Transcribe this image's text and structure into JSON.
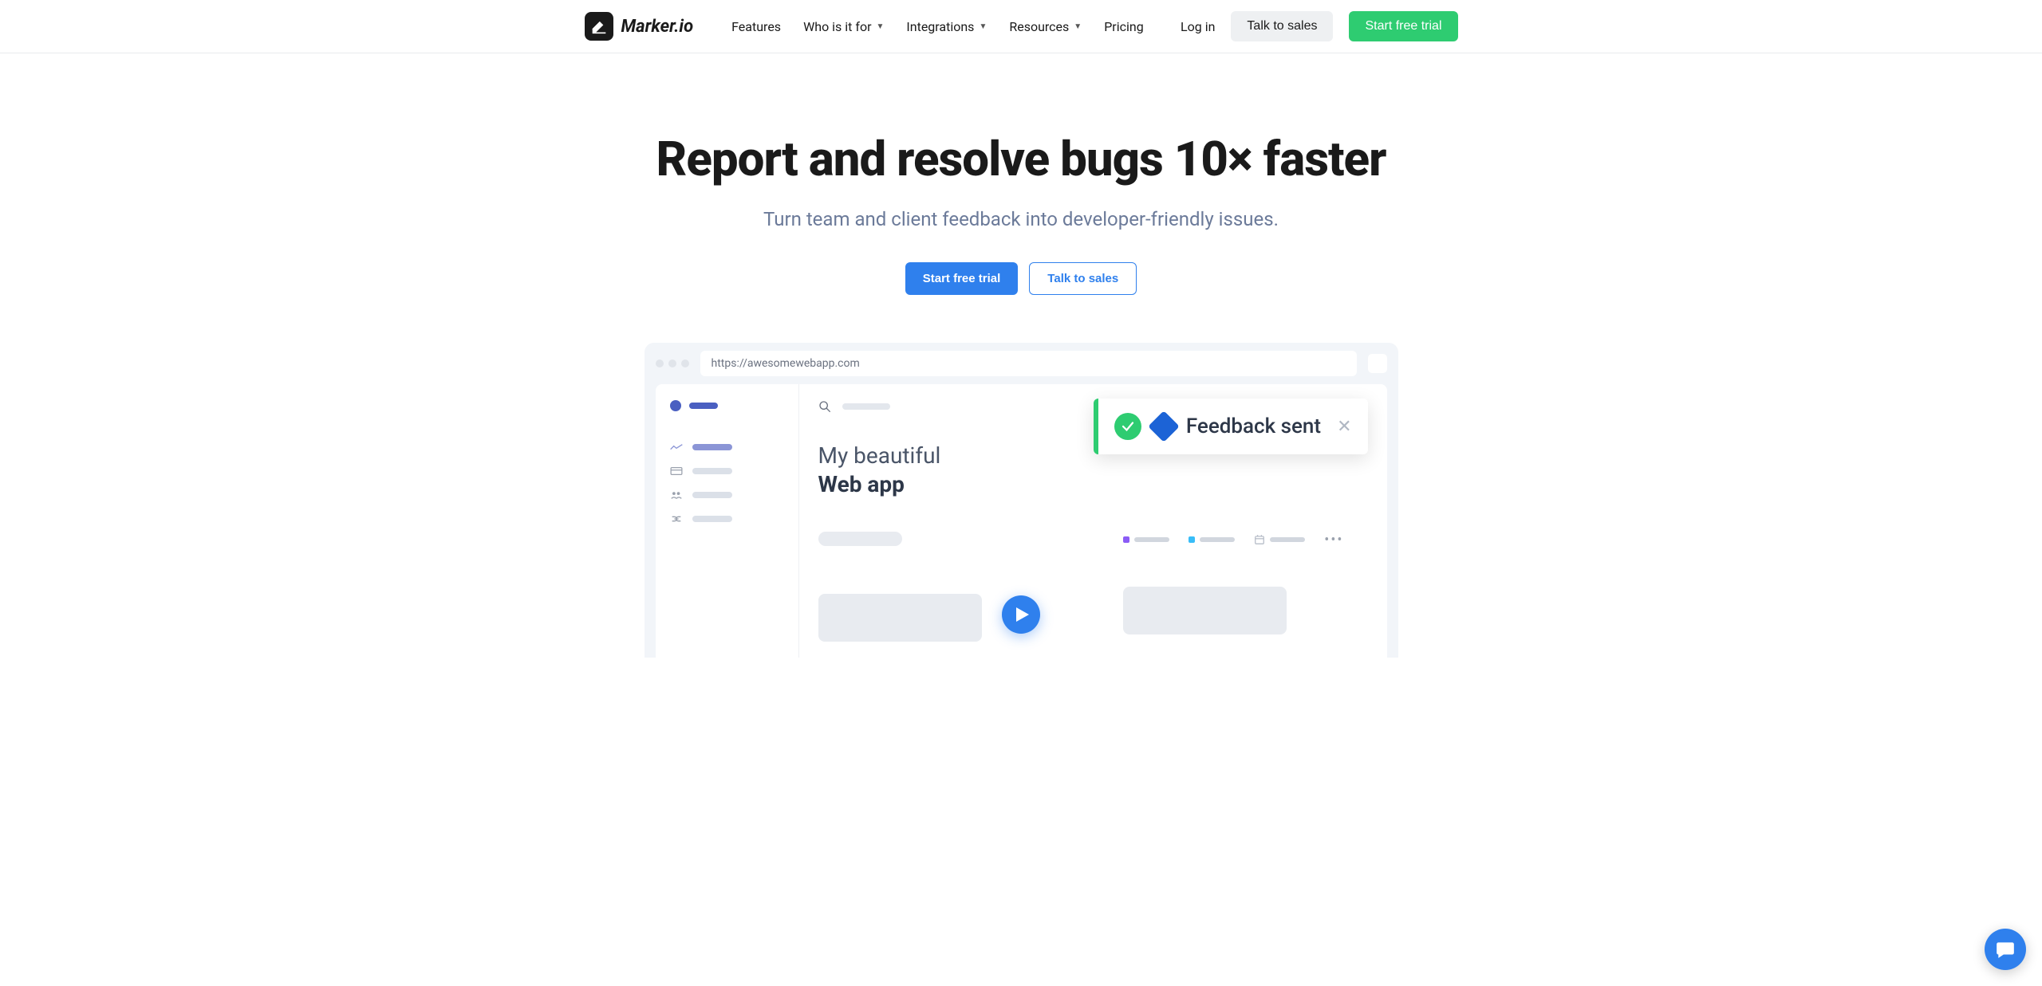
{
  "brand": {
    "name": "Marker.io"
  },
  "nav": {
    "items": [
      {
        "label": "Features",
        "dropdown": false
      },
      {
        "label": "Who is it for",
        "dropdown": true
      },
      {
        "label": "Integrations",
        "dropdown": true
      },
      {
        "label": "Resources",
        "dropdown": true
      },
      {
        "label": "Pricing",
        "dropdown": false
      }
    ],
    "login_label": "Log in",
    "sales_label": "Talk to sales",
    "trial_label": "Start free trial"
  },
  "hero": {
    "title": "Report and resolve bugs 10× faster",
    "subtitle": "Turn team and client feedback into developer-friendly issues.",
    "cta_primary": "Start free trial",
    "cta_secondary": "Talk to sales"
  },
  "illustration": {
    "url": "https://awesomewebapp.com",
    "app_title_line1": "My beautiful",
    "app_title_line2": "Web app",
    "toast_text": "Feedback sent"
  },
  "colors": {
    "green": "#2ecc71",
    "blue": "#2f80ed"
  }
}
